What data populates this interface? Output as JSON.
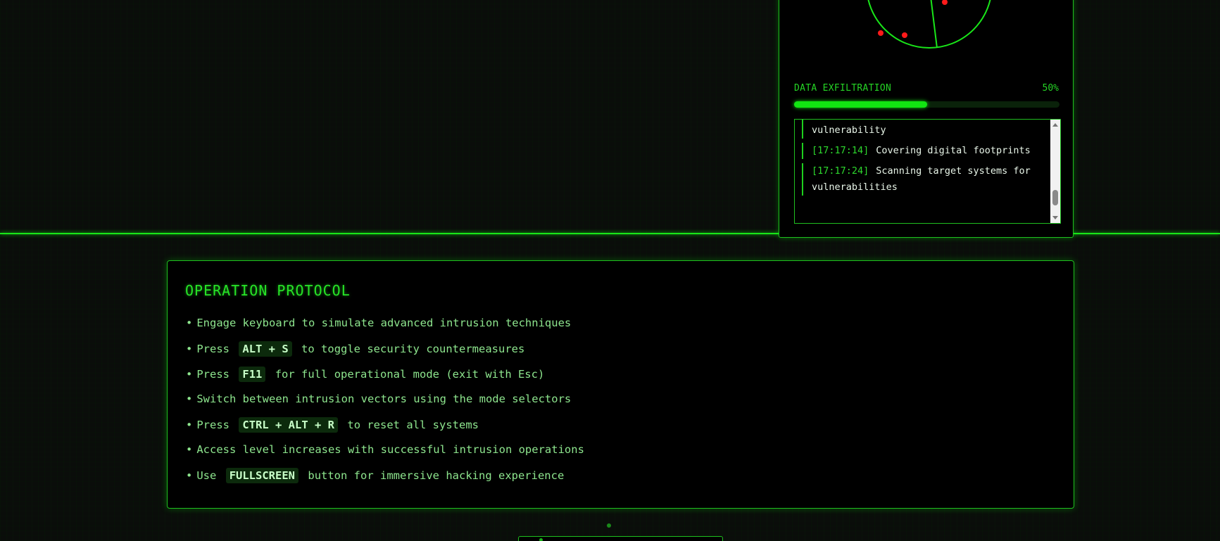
{
  "monitor": {
    "exfil_label": "DATA EXFILTRATION",
    "exfil_percent": "50%",
    "exfil_progress": 0.5,
    "log_entries": [
      {
        "time": "",
        "text": "vulnerability"
      },
      {
        "time": "[17:17:14]",
        "text": "Covering digital footprints"
      },
      {
        "time": "[17:17:24]",
        "text": "Scanning target systems for vulnerabilities"
      }
    ]
  },
  "protocol": {
    "title": "OPERATION PROTOCOL",
    "items": [
      {
        "pre": "Engage keyboard to simulate advanced intrusion techniques",
        "key": "",
        "post": ""
      },
      {
        "pre": "Press",
        "key": "ALT + S",
        "post": "to toggle security countermeasures"
      },
      {
        "pre": "Press",
        "key": "F11",
        "post": "for full operational mode (exit with Esc)"
      },
      {
        "pre": "Switch between intrusion vectors using the mode selectors",
        "key": "",
        "post": ""
      },
      {
        "pre": "Press",
        "key": "CTRL + ALT + R",
        "post": "to reset all systems"
      },
      {
        "pre": "Access level increases with successful intrusion operations",
        "key": "",
        "post": ""
      },
      {
        "pre": "Use",
        "key": "FULLSCREEN",
        "post": "button for immersive hacking experience"
      }
    ]
  },
  "colors": {
    "accent": "#19e619",
    "text": "#8ee68e",
    "panel_bg": "#000000",
    "blip": "#ff1a1a"
  }
}
